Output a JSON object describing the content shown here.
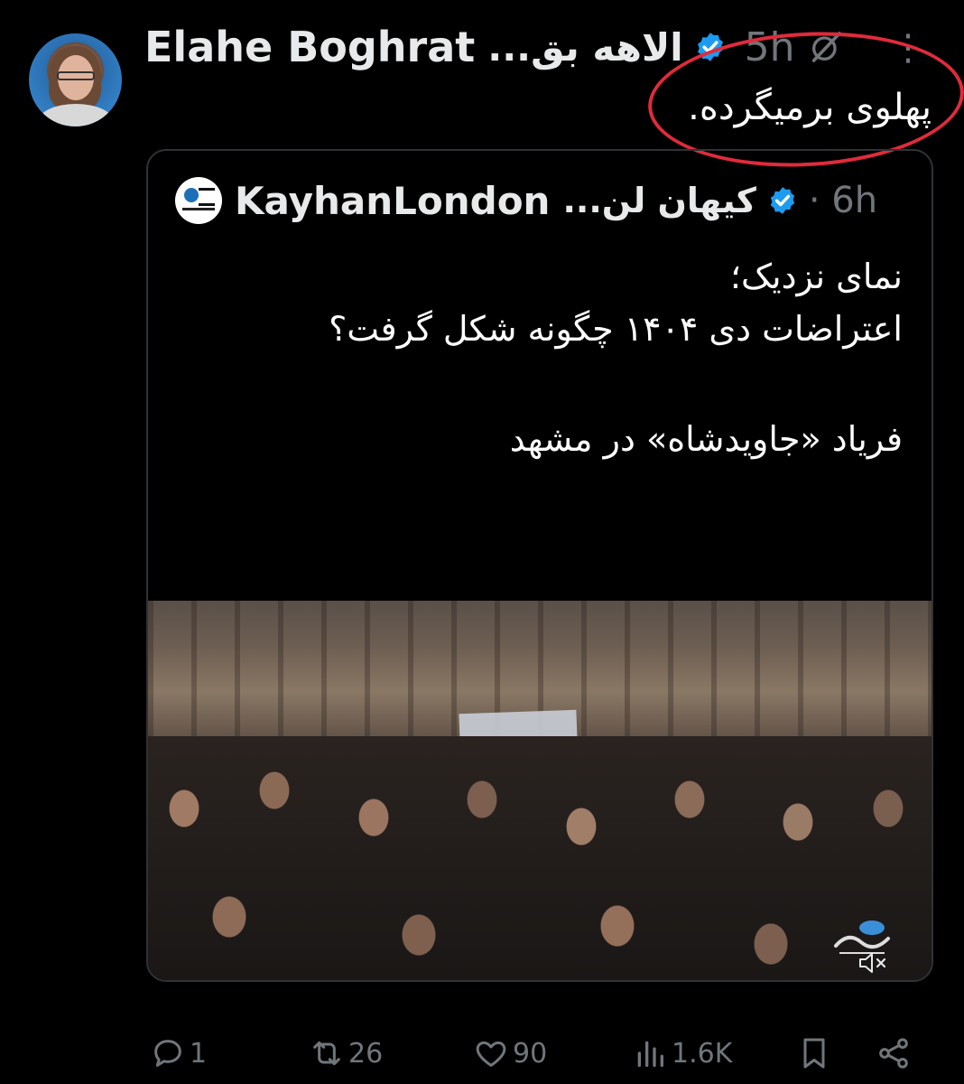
{
  "tweet": {
    "author_name": "Elahe Boghrat",
    "author_name_fa": "الاهه بق...",
    "time": "5h",
    "more": "⋮",
    "text": "پهلوی برمیگرده."
  },
  "quote": {
    "author_name": "KayhanLondon",
    "author_name_fa": "کیهان لن...",
    "time": "· 6h",
    "lines": [
      "نمای نزدیک؛",
      "اعتراضات دی ۱۴۰۴ چگونه شکل گرفت؟",
      "فریاد «جاویدشاه» در مشهد"
    ],
    "ellipsis": "..."
  },
  "actions": {
    "replies": "1",
    "reposts": "26",
    "likes": "90",
    "views": "1.6K"
  },
  "colors": {
    "background": "#000000",
    "text": "#e7e9ea",
    "muted": "#71767b",
    "verified": "#1d9bf0",
    "annotation": "#e02b3c"
  },
  "icons": [
    "verified-badge-icon",
    "grok-icon",
    "more-icon",
    "reply-icon",
    "repost-icon",
    "like-icon",
    "views-icon",
    "bookmark-icon",
    "share-icon",
    "mute-icon"
  ]
}
